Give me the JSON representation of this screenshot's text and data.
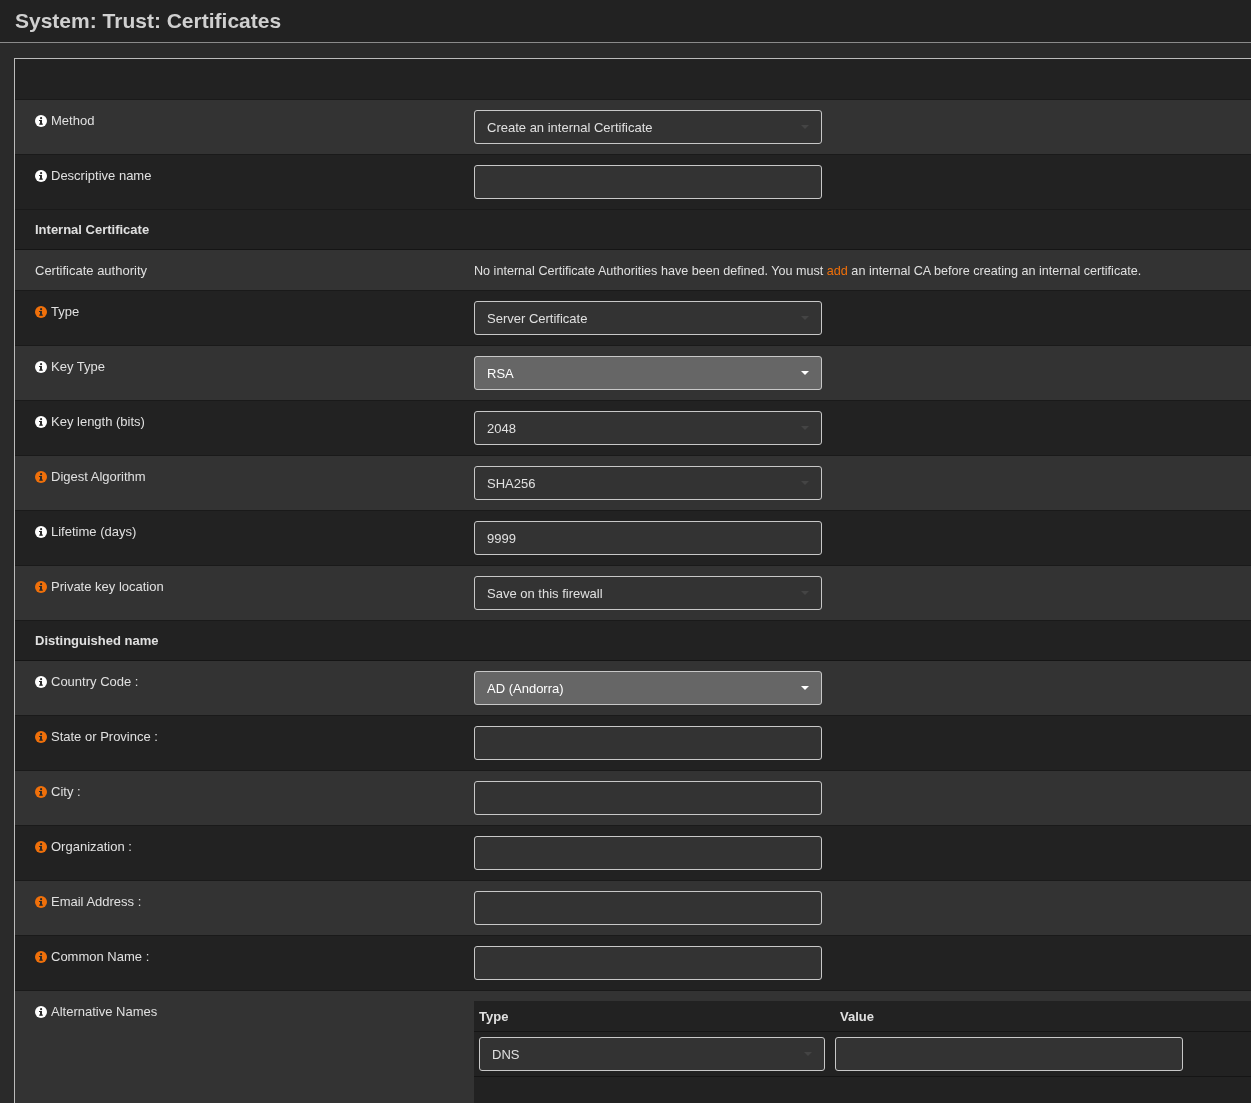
{
  "page_title": "System: Trust: Certificates",
  "rows": [
    {
      "kind": "select",
      "label": "Method",
      "color": "#ffffff",
      "value": "Create an internal Certificate"
    },
    {
      "kind": "input",
      "label": "Descriptive name",
      "color": "#ffffff"
    },
    {
      "kind": "section",
      "label": "Internal Certificate"
    },
    {
      "kind": "text",
      "label": "Certificate authority",
      "text_before": "No internal Certificate Authorities have been defined. You must",
      "link": "add",
      "text_after": "an internal CA before creating an internal certificate."
    },
    {
      "kind": "select",
      "label": "Type",
      "color": "#f0700a",
      "value": "Server Certificate"
    },
    {
      "kind": "picker",
      "label": "Key Type",
      "color": "#ffffff",
      "value": "RSA"
    },
    {
      "kind": "select",
      "label": "Key length (bits)",
      "color": "#ffffff",
      "value": "2048"
    },
    {
      "kind": "select",
      "label": "Digest Algorithm",
      "color": "#f0700a",
      "value": "SHA256"
    },
    {
      "kind": "input",
      "label": "Lifetime (days)",
      "color": "#ffffff",
      "value": "9999"
    },
    {
      "kind": "select",
      "label": "Private key location",
      "color": "#f0700a",
      "value": "Save on this firewall"
    },
    {
      "kind": "section",
      "label": "Distinguished name"
    },
    {
      "kind": "picker",
      "label": "Country Code :",
      "color": "#ffffff",
      "value": "AD (Andorra)"
    },
    {
      "kind": "input",
      "label": "State or Province :",
      "color": "#f0700a"
    },
    {
      "kind": "input",
      "label": "City :",
      "color": "#f0700a"
    },
    {
      "kind": "input",
      "label": "Organization :",
      "color": "#f0700a"
    },
    {
      "kind": "input",
      "label": "Email Address :",
      "color": "#f0700a"
    },
    {
      "kind": "input",
      "label": "Common Name :",
      "color": "#f0700a"
    },
    {
      "kind": "table",
      "label": "Alternative Names",
      "color": "#ffffff",
      "columns": [
        "Type",
        "Value"
      ],
      "entries": [
        {
          "type": "DNS"
        }
      ]
    }
  ]
}
